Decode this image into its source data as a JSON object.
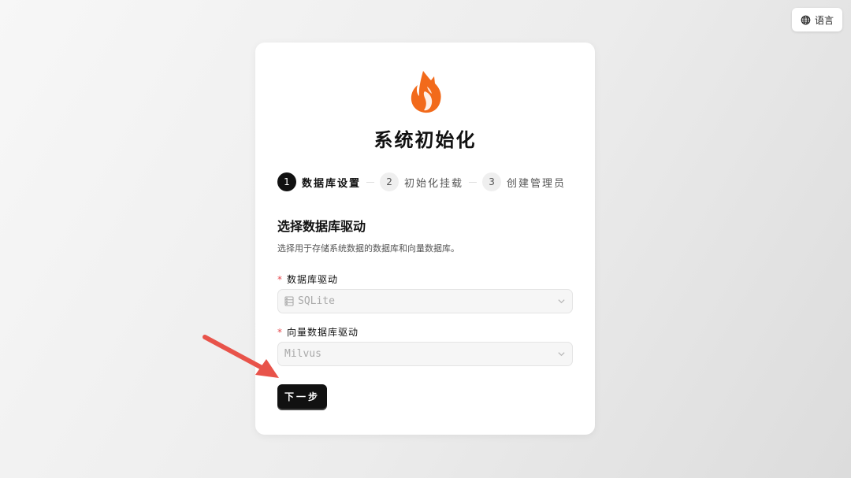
{
  "header": {
    "language_label": "语言",
    "language_icon": "globe-icon"
  },
  "card": {
    "logo_icon": "fox-flame-logo",
    "title": "系统初始化",
    "steps": [
      {
        "number": "1",
        "label": "数据库设置",
        "active": true
      },
      {
        "number": "2",
        "label": "初始化挂载",
        "active": false
      },
      {
        "number": "3",
        "label": "创建管理员",
        "active": false
      }
    ],
    "section": {
      "title": "选择数据库驱动",
      "description": "选择用于存储系统数据的数据库和向量数据库。"
    },
    "fields": {
      "db_driver": {
        "required_mark": "*",
        "label": "数据库驱动",
        "value": "SQLite",
        "icon": "database-icon"
      },
      "vector_driver": {
        "required_mark": "*",
        "label": "向量数据库驱动",
        "value": "Milvus"
      }
    },
    "next_label": "下一步"
  },
  "annotation": {
    "arrow_color": "#e8534a"
  },
  "colors": {
    "accent": "#111111",
    "logo": "#f26a1b",
    "required": "#e5484d"
  }
}
